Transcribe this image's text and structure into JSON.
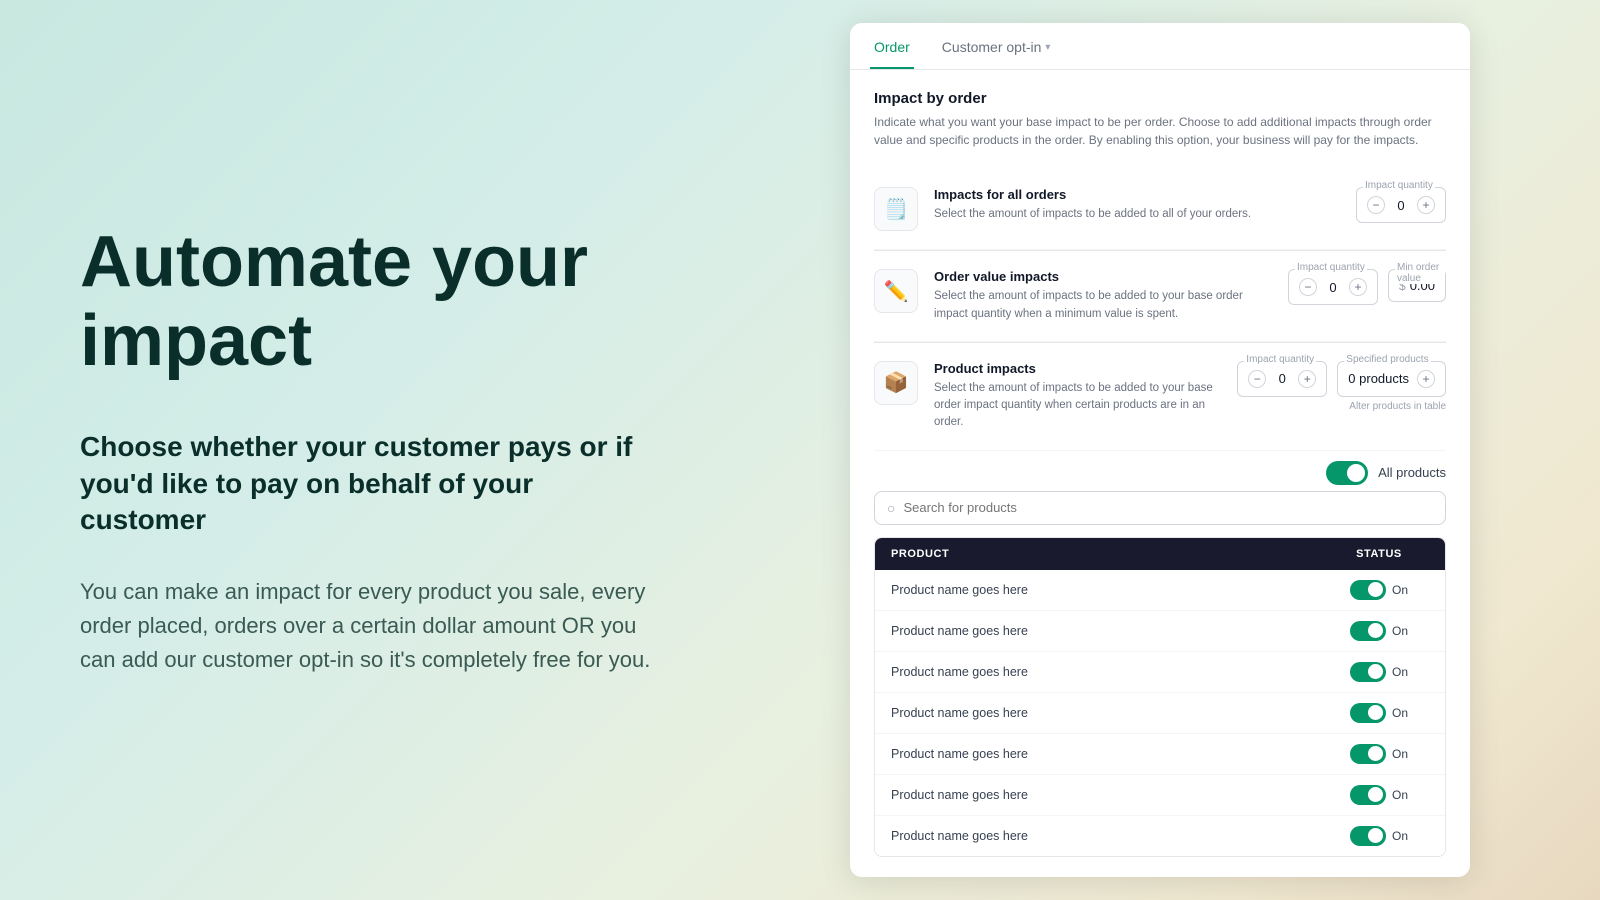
{
  "left": {
    "headline_line1": "Automate your",
    "headline_line2": "impact",
    "subheadline": "Choose whether your customer pays or if you'd like to pay on behalf of your customer",
    "body": "You can make an impact for every product you sale, every order placed, orders over a certain dollar amount OR you can add our customer opt-in so it's completely free for you."
  },
  "tabs": [
    {
      "label": "Order",
      "active": true
    },
    {
      "label": "Customer opt-in",
      "active": false,
      "chevron": "▾"
    }
  ],
  "section": {
    "title": "Impact by order",
    "description": "Indicate what you want your base impact to be per order. Choose to add additional impacts through order value and specific products in the order. By enabling this option, your business will pay for the impacts."
  },
  "impacts": [
    {
      "icon": "📋",
      "label": "Impacts for all orders",
      "desc": "Select the amount of impacts to be added to all of your orders.",
      "qty_label": "Impact quantity",
      "qty": "0",
      "has_min_order": false,
      "has_spec_products": false
    },
    {
      "icon": "✏️",
      "label": "Order value impacts",
      "desc": "Select the amount of impacts to be added to your base order impact quantity when a minimum value is spent.",
      "qty_label": "Impact quantity",
      "qty": "0",
      "has_min_order": true,
      "min_order_label": "Min order value",
      "min_order_symbol": "$",
      "min_order_value": "0.00",
      "has_spec_products": false
    },
    {
      "icon": "📦",
      "label": "Product impacts",
      "desc": "Select the amount of impacts to be added to your base order impact quantity when certain products are in an order.",
      "qty_label": "Impact quantity",
      "qty": "0",
      "has_min_order": false,
      "has_spec_products": true,
      "spec_label": "Specified products",
      "spec_value": "0 products",
      "alter_text": "Alter products in table"
    }
  ],
  "toggle": {
    "label": "All products"
  },
  "search": {
    "placeholder": "Search for products"
  },
  "table": {
    "col_product": "PRODUCT",
    "col_status": "STATUS",
    "rows": [
      {
        "name": "Product name goes here",
        "status": "On"
      },
      {
        "name": "Product name goes here",
        "status": "On"
      },
      {
        "name": "Product name goes here",
        "status": "On"
      },
      {
        "name": "Product name goes here",
        "status": "On"
      },
      {
        "name": "Product name goes here",
        "status": "On"
      },
      {
        "name": "Product name goes here",
        "status": "On"
      },
      {
        "name": "Product name goes here",
        "status": "On"
      }
    ]
  },
  "colors": {
    "accent": "#059669",
    "dark": "#0a2e2a"
  }
}
